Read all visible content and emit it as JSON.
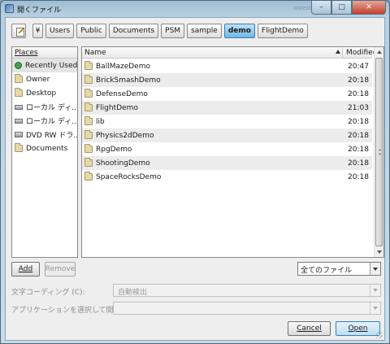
{
  "window": {
    "title": "開くファイル",
    "background_title": "ontext",
    "minimize_icon": "minimize-icon",
    "maximize_icon": "maximize-icon",
    "close_icon": "close-icon",
    "min_glyph": "–",
    "max_glyph": "□",
    "close_glyph": "✕"
  },
  "pathbar": {
    "edit_icon": "pencil-icon",
    "segments": [
      "¥",
      "Users",
      "Public",
      "Documents",
      "PSM",
      "sample",
      "demo",
      "FlightDemo"
    ],
    "active_segment": "demo"
  },
  "places": {
    "header": "Places",
    "items": [
      {
        "label": "Recently Used",
        "icon": "recently-used-icon"
      },
      {
        "label": "Owner",
        "icon": "folder-icon"
      },
      {
        "label": "Desktop",
        "icon": "folder-icon"
      },
      {
        "label": "ローカル ディ...",
        "icon": "drive-icon"
      },
      {
        "label": "ローカル ディ...",
        "icon": "drive-icon"
      },
      {
        "label": "DVD RW ドラ...",
        "icon": "dvd-drive-icon"
      },
      {
        "label": "Documents",
        "icon": "folder-icon"
      }
    ],
    "selected_index": 0
  },
  "files": {
    "columns": {
      "name": "Name",
      "modified": "Modified"
    },
    "rows": [
      {
        "name": "BallMazeDemo",
        "modified": "20:47"
      },
      {
        "name": "BrickSmashDemo",
        "modified": "20:18"
      },
      {
        "name": "DefenseDemo",
        "modified": "20:18"
      },
      {
        "name": "FlightDemo",
        "modified": "21:03"
      },
      {
        "name": "lib",
        "modified": "20:18"
      },
      {
        "name": "Physics2dDemo",
        "modified": "20:18"
      },
      {
        "name": "RpgDemo",
        "modified": "20:18"
      },
      {
        "name": "ShootingDemo",
        "modified": "20:18"
      },
      {
        "name": "SpaceRocksDemo",
        "modified": "20:18"
      }
    ]
  },
  "actions": {
    "add": "Add",
    "remove": "Remove"
  },
  "filter": {
    "value": "全てのファイル"
  },
  "encoding": {
    "label": "文字コーディング (C):",
    "value": "自動検出"
  },
  "app": {
    "label": "アプリケーションを選択して開く:",
    "value": ""
  },
  "buttons": {
    "cancel": "Cancel",
    "open": "Open"
  }
}
